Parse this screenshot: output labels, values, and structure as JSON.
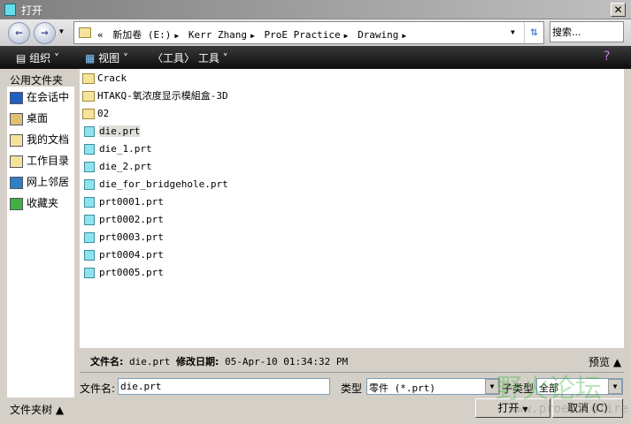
{
  "title": "打开",
  "address": {
    "crumbs": [
      "«",
      "新加卷 (E:)",
      "Kerr Zhang",
      "ProE Practice",
      "Drawing"
    ]
  },
  "search_placeholder": "搜索...",
  "toolbar": {
    "organize": "组织",
    "views": "视图",
    "tools_prefix": "〈工具〉",
    "tools": "工具"
  },
  "sidebar": {
    "header": "公用文件夹",
    "items": [
      {
        "label": "在会话中",
        "icon": "session-icon",
        "color": "#2060c0"
      },
      {
        "label": "桌面",
        "icon": "desktop-icon",
        "color": "#e0c070"
      },
      {
        "label": "我的文档",
        "icon": "my-documents-icon",
        "color": "#f5e39a"
      },
      {
        "label": "工作目录",
        "icon": "working-directory-icon",
        "color": "#f5e39a"
      },
      {
        "label": "网上邻居",
        "icon": "network-icon",
        "color": "#3080c0"
      },
      {
        "label": "收藏夹",
        "icon": "favorites-icon",
        "color": "#40b040"
      }
    ]
  },
  "files": [
    {
      "name": "Crack",
      "type": "folder"
    },
    {
      "name": "HTAKQ-氧浓度显示模組盒-3D",
      "type": "folder"
    },
    {
      "name": "02",
      "type": "folder"
    },
    {
      "name": "die.prt",
      "type": "prt",
      "selected": true
    },
    {
      "name": "die_1.prt",
      "type": "prt"
    },
    {
      "name": "die_2.prt",
      "type": "prt"
    },
    {
      "name": "die_for_bridgehole.prt",
      "type": "prt"
    },
    {
      "name": "prt0001.prt",
      "type": "prt"
    },
    {
      "name": "prt0002.prt",
      "type": "prt"
    },
    {
      "name": "prt0003.prt",
      "type": "prt"
    },
    {
      "name": "prt0004.prt",
      "type": "prt"
    },
    {
      "name": "prt0005.prt",
      "type": "prt"
    }
  ],
  "details": {
    "filename_label": "文件名:",
    "filename": "die.prt",
    "modified_label": "修改日期:",
    "modified": "05-Apr-10 01:34:32 PM",
    "preview": "预览 ▲"
  },
  "bottom": {
    "filename_label": "文件名:",
    "filename_value": "die.prt",
    "type_label": "类型",
    "type_value": "零件 (*.prt)",
    "subtype_label": "子类型",
    "subtype_value": "全部",
    "tree_toggle": "文件夹树 ▲",
    "open": "打开",
    "cancel": "取消 (C)"
  },
  "watermark": {
    "text": "野火论坛",
    "url": "www.proewildfire.cn"
  }
}
